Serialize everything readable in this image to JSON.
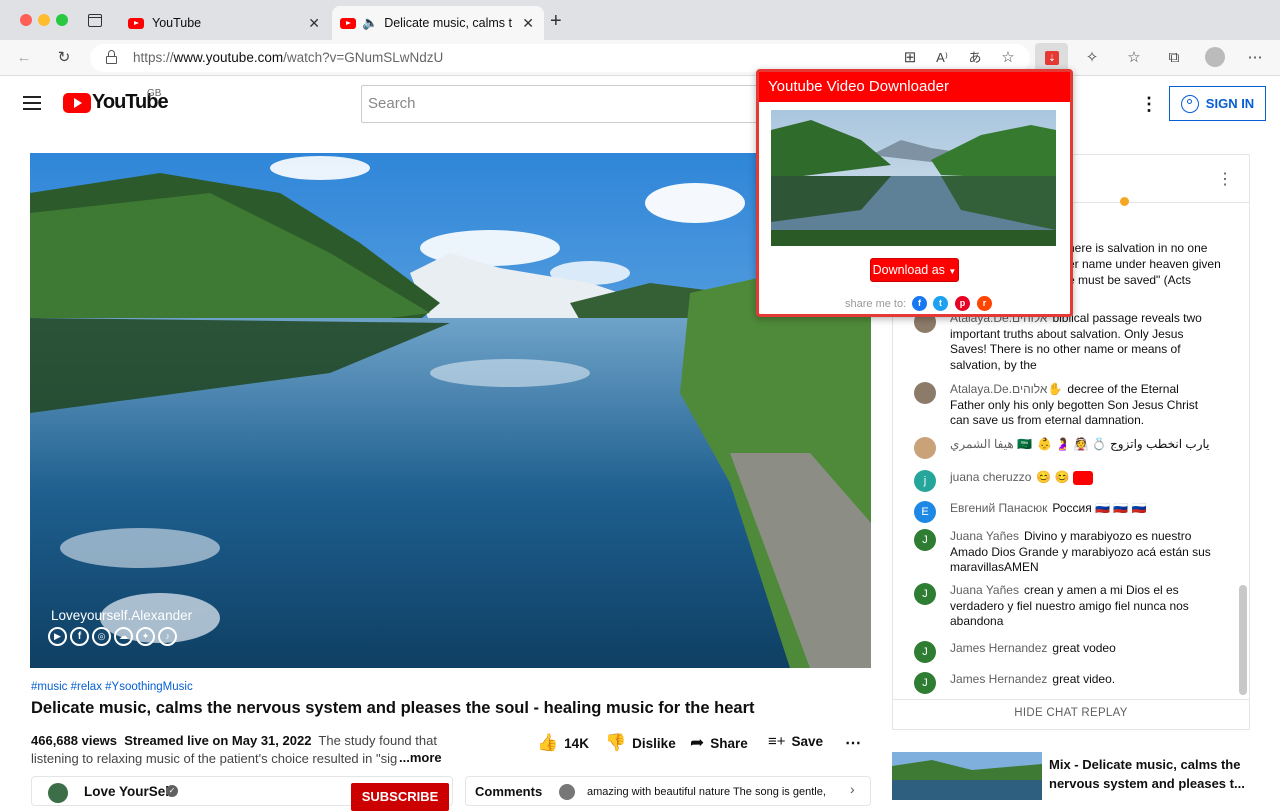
{
  "browser": {
    "tabs": [
      {
        "label": "YouTube"
      },
      {
        "label": "Delicate music, calms the"
      }
    ],
    "url_prefix": "https://",
    "url_domain": "www.youtube.com",
    "url_path": "/watch?v=GNumSLwNdzU"
  },
  "header": {
    "logo_text": "YouTube",
    "region": "GB",
    "search_placeholder": "Search",
    "signin_label": "SIGN IN"
  },
  "video": {
    "watermark": "Loveyourself.Alexander",
    "hashtags": "#music #relax #YsoothingMusic",
    "title": "Delicate music, calms the nervous system and pleases the soul - healing music for the heart",
    "views": "466,688 views",
    "streamed": "Streamed live on May 31, 2022",
    "desc_line1": "The study found that",
    "desc_line2": "listening to relaxing music of the patient's choice resulted in \"sign",
    "more": "...more",
    "likes": "14K",
    "dislike": "Dislike",
    "share": "Share",
    "save": "Save",
    "channel": "Love YourSelf",
    "subscribe": "SUBSCRIBE",
    "comments_label": "Comments",
    "comment_preview": "amazing with beautiful nature The song is gentle,"
  },
  "chat": {
    "top_partial": [
      "here is salvation in no one",
      "er name under heaven given",
      "e must be saved\" (Acts"
    ],
    "messages": [
      {
        "author": "Atalaya.De.אלוהים",
        "text": "biblical passage reveals two important truths about salvation. Only Jesus Saves! There is no other name or means of salvation, by the",
        "avatar": "",
        "color": "#8d7b6a"
      },
      {
        "author": "Atalaya.De.אלוהים✋",
        "text": "decree of the Eternal Father only his only begotten Son Jesus Christ can save us from eternal damnation.",
        "avatar": "",
        "color": "#8d7b6a"
      },
      {
        "author": "هيفا الشمري 🇸🇦",
        "text": "يارب انخطب واتزوج",
        "avatar": "",
        "color": "#c9a27a"
      },
      {
        "author": "juana cheruzzo",
        "text": "😊 😊",
        "avatar": "j",
        "color": "#26a69a"
      },
      {
        "author": "Евгений Панасюк",
        "text": "Россия 🇷🇺 🇷🇺 🇷🇺",
        "avatar": "E",
        "color": "#1e88e5"
      },
      {
        "author": "Juana Yañes",
        "text": "Divino y marabiyozo es nuestro Amado Dios Grande y marabiyozo acá están sus maravillasAMEN",
        "avatar": "J",
        "color": "#2e7d32"
      },
      {
        "author": "Juana Yañes",
        "text": "crean y amen a mi Dios el es verdadero y fiel nuestro amigo fiel nunca nos abandona",
        "avatar": "J",
        "color": "#2e7d32"
      },
      {
        "author": "James Hernandez",
        "text": "great vodeo",
        "avatar": "J",
        "color": "#2e7d32"
      },
      {
        "author": "James Hernandez",
        "text": "great video.",
        "avatar": "J",
        "color": "#2e7d32"
      }
    ],
    "hide_replay": "HIDE CHAT REPLAY"
  },
  "popup": {
    "title": "Youtube Video Downloader",
    "download_label": "Download as",
    "share_label": "share me to:"
  },
  "recommendation": {
    "title_line1": "Mix - Delicate music, calms the",
    "title_line2": "nervous system and pleases t..."
  },
  "colors": {
    "accent_red": "#ff0000",
    "link_blue": "#065fd4"
  }
}
